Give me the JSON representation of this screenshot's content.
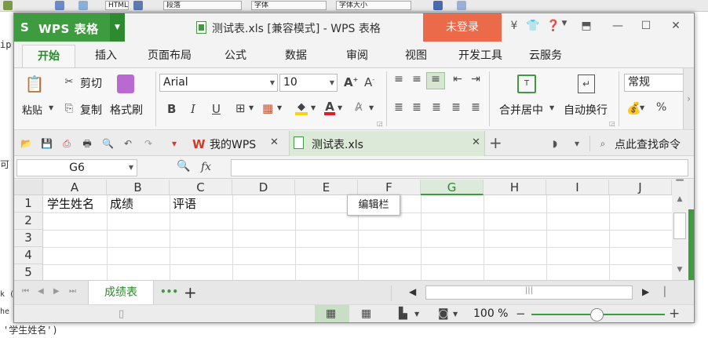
{
  "background_editor": {
    "toolbar_items": [
      "HTML",
      "段落",
      "字体",
      "字体大小"
    ],
    "left_text": [
      "ip",
      "可",
      "k (",
      "he"
    ],
    "bottom_text": "'学生姓名')"
  },
  "app": {
    "logo": "S",
    "name": "WPS 表格",
    "doc_title": "测试表.xls [兼容模式] - WPS 表格",
    "login": "未登录"
  },
  "menu": {
    "tabs": [
      "开始",
      "插入",
      "页面布局",
      "公式",
      "数据",
      "审阅",
      "视图",
      "开发工具",
      "云服务"
    ]
  },
  "ribbon": {
    "paste": "粘贴",
    "cut": "剪切",
    "copy": "复制",
    "format_painter": "格式刷",
    "font_name": "Arial",
    "font_size": "10",
    "bold": "B",
    "italic": "I",
    "underline": "U",
    "merge_center": "合并居中",
    "wrap_text": "自动换行",
    "number_format": "常规",
    "percent": "%"
  },
  "doc_tabs": {
    "mywps": "我的WPS",
    "file": "测试表.xls",
    "find_command": "点此查找命令"
  },
  "formula_bar": {
    "cell_ref": "G6",
    "fx": "fx",
    "value": ""
  },
  "grid": {
    "columns": [
      "A",
      "B",
      "C",
      "D",
      "E",
      "F",
      "G",
      "H",
      "I",
      "J"
    ],
    "selected_column": "G",
    "rows": [
      "1",
      "2",
      "3",
      "4",
      "5"
    ],
    "cells": {
      "A1": "学生姓名",
      "B1": "成绩",
      "C1": "评语"
    }
  },
  "tooltip": "编辑栏",
  "sheets": {
    "active": "成绩表",
    "more": "•••",
    "add": "+"
  },
  "status": {
    "zoom": "100 %",
    "minus": "−",
    "plus": "+"
  }
}
